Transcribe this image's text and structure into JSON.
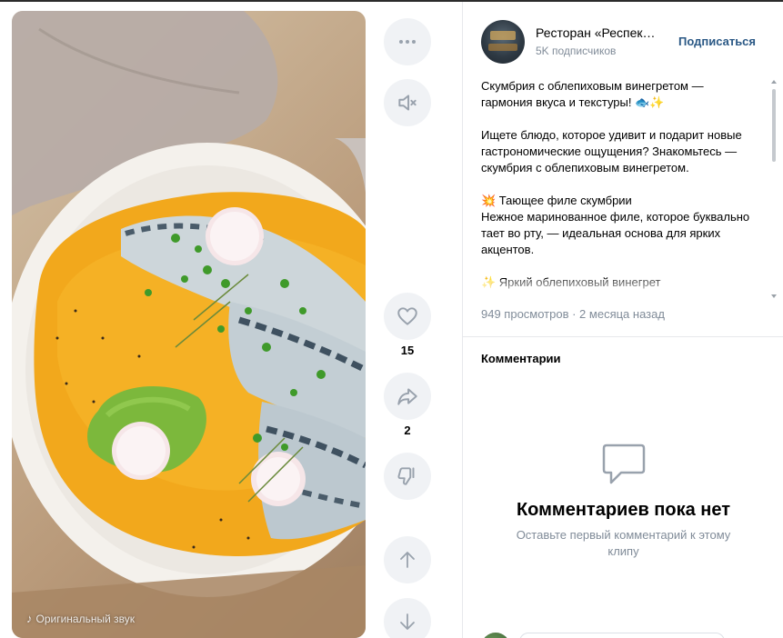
{
  "video": {
    "sound_label": "Оригинальный звук",
    "sound_icon": "music-note-icon"
  },
  "actions": {
    "more_icon": "more-horizontal-icon",
    "mute_icon": "volume-muted-icon",
    "like_icon": "heart-icon",
    "likes": "15",
    "share_icon": "share-icon",
    "shares": "2",
    "dislike_icon": "dislike-icon",
    "prev_icon": "arrow-up-icon",
    "next_icon": "arrow-down-icon"
  },
  "author": {
    "name": "Ресторан «Респек…",
    "subscribers": "5K подписчиков",
    "subscribe_label": "Подписаться"
  },
  "description": {
    "p1": "Скумбрия с облепиховым винегретом — гармония вкуса и текстуры! 🐟✨",
    "p2": "Ищете блюдо, которое удивит и подарит новые гастрономические ощущения? Знакомьтесь — скумбрия с облепиховым винегретом.",
    "p3": "💥 Тающее филе скумбрии\nНежное маринованное филе, которое буквально тает во рту, — идеальная основа для ярких акцентов.",
    "p4": "✨ Яркий облепиховый винегрет"
  },
  "stats": {
    "views": "949 просмотров · 2 месяца назад"
  },
  "comments": {
    "title": "Комментарии",
    "empty_icon": "comment-bubble-icon",
    "empty_title": "Комментариев пока нет",
    "empty_subtitle": "Оставьте первый комментарий к этому клипу"
  },
  "colors": {
    "accent": "#2a5885",
    "muted": "#818c99",
    "button_bg": "#f0f2f5",
    "icon": "#99a2ad"
  }
}
